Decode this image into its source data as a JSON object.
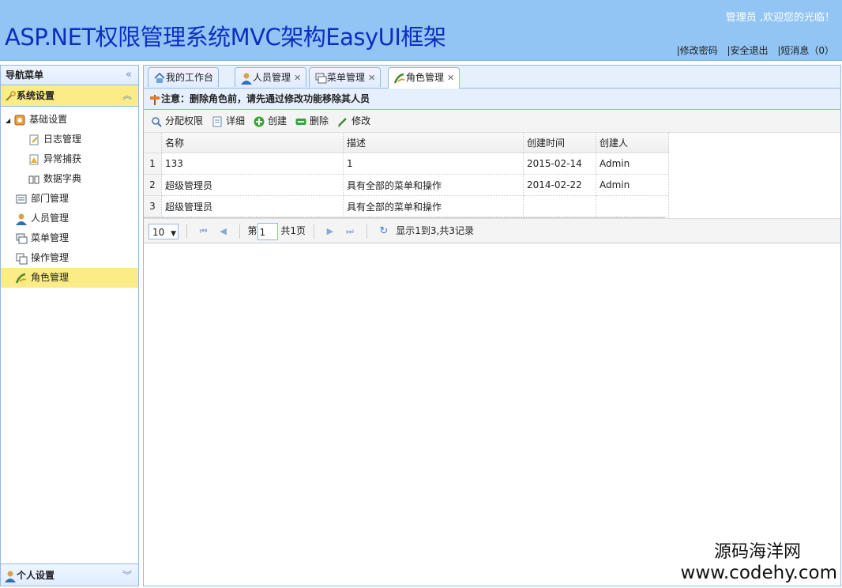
{
  "header": {
    "title": "ASP.NET权限管理系统MVC架构EasyUI框架",
    "welcome": "管理员 ,欢迎您的光临！",
    "links": [
      "|修改密码",
      "|安全退出",
      "|短消息（0）"
    ]
  },
  "sidebar": {
    "title": "导航菜单",
    "section": "系统设置",
    "tree": [
      {
        "label": "基础设置",
        "icon": "gear-icon",
        "level": 0,
        "expander": "◢"
      },
      {
        "label": "日志管理",
        "icon": "log-icon",
        "level": 2
      },
      {
        "label": "异常捕获",
        "icon": "warning-icon",
        "level": 2
      },
      {
        "label": "数据字典",
        "icon": "book-icon",
        "level": 2
      },
      {
        "label": "部门管理",
        "icon": "department-icon",
        "level": 1
      },
      {
        "label": "人员管理",
        "icon": "user-icon",
        "level": 1
      },
      {
        "label": "菜单管理",
        "icon": "menu-icon",
        "level": 1
      },
      {
        "label": "操作管理",
        "icon": "operation-icon",
        "level": 1
      },
      {
        "label": "角色管理",
        "icon": "role-icon",
        "level": 1,
        "selected": true
      }
    ],
    "footer": "个人设置"
  },
  "tabs": [
    {
      "label": "我的工作台",
      "icon": "home-icon",
      "closable": false
    },
    {
      "label": "人员管理",
      "icon": "user-icon",
      "closable": true
    },
    {
      "label": "菜单管理",
      "icon": "menu-icon",
      "closable": true
    },
    {
      "label": "角色管理",
      "icon": "role-icon",
      "closable": true,
      "active": true
    }
  ],
  "notice": "注意：删除角色前，请先通过修改功能移除其人员",
  "toolbar": [
    {
      "label": "分配权限",
      "icon": "search-icon"
    },
    {
      "label": "详细",
      "icon": "document-icon"
    },
    {
      "label": "创建",
      "icon": "add-icon"
    },
    {
      "label": "删除",
      "icon": "remove-icon"
    },
    {
      "label": "修改",
      "icon": "edit-icon"
    }
  ],
  "grid": {
    "columns": [
      "名称",
      "描述",
      "创建时间",
      "创建人"
    ],
    "rows": [
      {
        "n": "1",
        "cells": [
          "133",
          "1",
          "2015-02-14",
          "Admin"
        ]
      },
      {
        "n": "2",
        "cells": [
          "超级管理员",
          "具有全部的菜单和操作",
          "2014-02-22",
          "Admin"
        ]
      },
      {
        "n": "3",
        "cells": [
          "超级管理员",
          "具有全部的菜单和操作",
          "",
          ""
        ]
      }
    ]
  },
  "pager": {
    "page_size": "10",
    "page_prefix": "第",
    "page": "1",
    "page_suffix": "共1页",
    "info": "显示1到3,共3记录"
  },
  "watermark": {
    "line1": "源码海洋网",
    "line2": "www.codehy.com"
  }
}
